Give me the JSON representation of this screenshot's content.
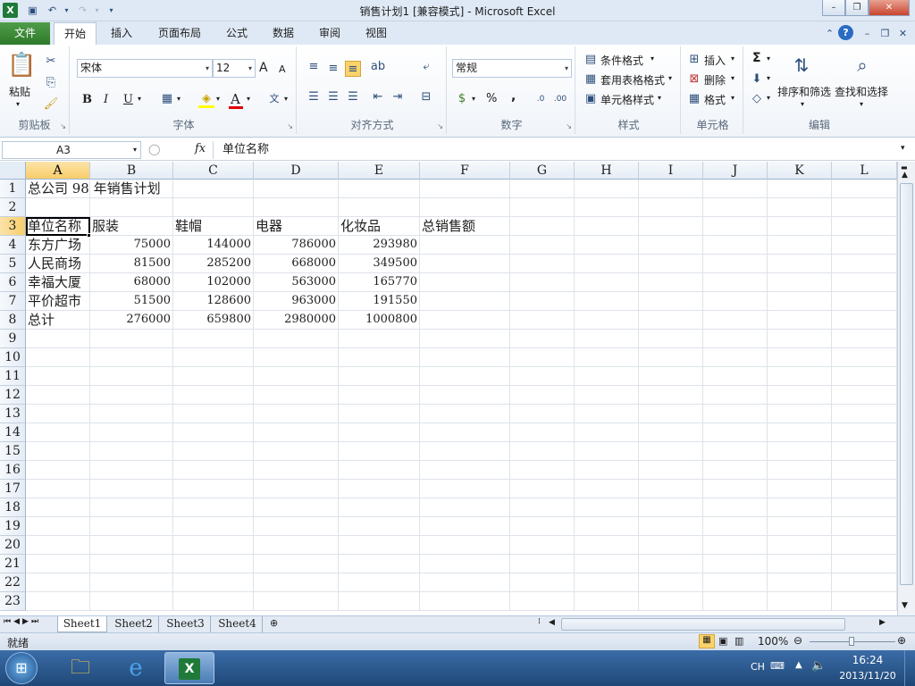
{
  "window": {
    "title": "销售计划1 [兼容模式] - Microsoft Excel"
  },
  "ribbon_tabs": {
    "file": "文件",
    "tabs": [
      "开始",
      "插入",
      "页面布局",
      "公式",
      "数据",
      "审阅",
      "视图"
    ]
  },
  "ribbon": {
    "clipboard": {
      "label": "剪贴板",
      "paste": "粘贴"
    },
    "font": {
      "label": "字体",
      "font_name": "宋体",
      "font_size": "12",
      "grow": "A",
      "shrink": "A",
      "bold": "B",
      "italic": "I",
      "underline": "U",
      "font_color": "A"
    },
    "alignment": {
      "label": "对齐方式"
    },
    "number": {
      "label": "数字",
      "format": "常规",
      "percent": "%",
      "comma": ","
    },
    "styles": {
      "label": "样式",
      "conditional": "条件格式",
      "table_format": "套用表格格式",
      "cell_styles": "单元格样式"
    },
    "cells": {
      "label": "单元格",
      "insert": "插入",
      "delete": "删除",
      "format": "格式"
    },
    "editing": {
      "label": "编辑",
      "sum": "Σ",
      "sort_filter": "排序和筛选",
      "find_select": "查找和选择"
    }
  },
  "formula_bar": {
    "name_box": "A3",
    "fx": "fx",
    "content": "单位名称"
  },
  "columns": [
    "A",
    "B",
    "C",
    "D",
    "E",
    "F",
    "G",
    "H",
    "I",
    "J",
    "K",
    "L"
  ],
  "rows": [
    "1",
    "2",
    "3",
    "4",
    "5",
    "6",
    "7",
    "8",
    "9",
    "10",
    "11",
    "12",
    "13",
    "14",
    "15",
    "16",
    "17",
    "18",
    "19",
    "20",
    "21",
    "22",
    "23"
  ],
  "sheet": {
    "r1": {
      "A": "总公司 98 年销售计划"
    },
    "r3": {
      "A": "单位名称",
      "B": "服装",
      "C": "鞋帽",
      "D": "电器",
      "E": "化妆品",
      "F": "总销售额"
    },
    "r4": {
      "A": "东方广场",
      "B": "75000",
      "C": "144000",
      "D": "786000",
      "E": "293980"
    },
    "r5": {
      "A": "人民商场",
      "B": "81500",
      "C": "285200",
      "D": "668000",
      "E": "349500"
    },
    "r6": {
      "A": "幸福大厦",
      "B": "68000",
      "C": "102000",
      "D": "563000",
      "E": "165770"
    },
    "r7": {
      "A": "平价超市",
      "B": "51500",
      "C": "128600",
      "D": "963000",
      "E": "191550"
    },
    "r8": {
      "A": "总计",
      "B": "276000",
      "C": "659800",
      "D": "2980000",
      "E": "1000800"
    }
  },
  "sheets": [
    "Sheet1",
    "Sheet2",
    "Sheet3",
    "Sheet4"
  ],
  "status": {
    "mode": "就绪",
    "zoom": "100%"
  },
  "taskbar": {
    "lang": "CH",
    "time": "16:24",
    "date": "2013/11/20"
  }
}
